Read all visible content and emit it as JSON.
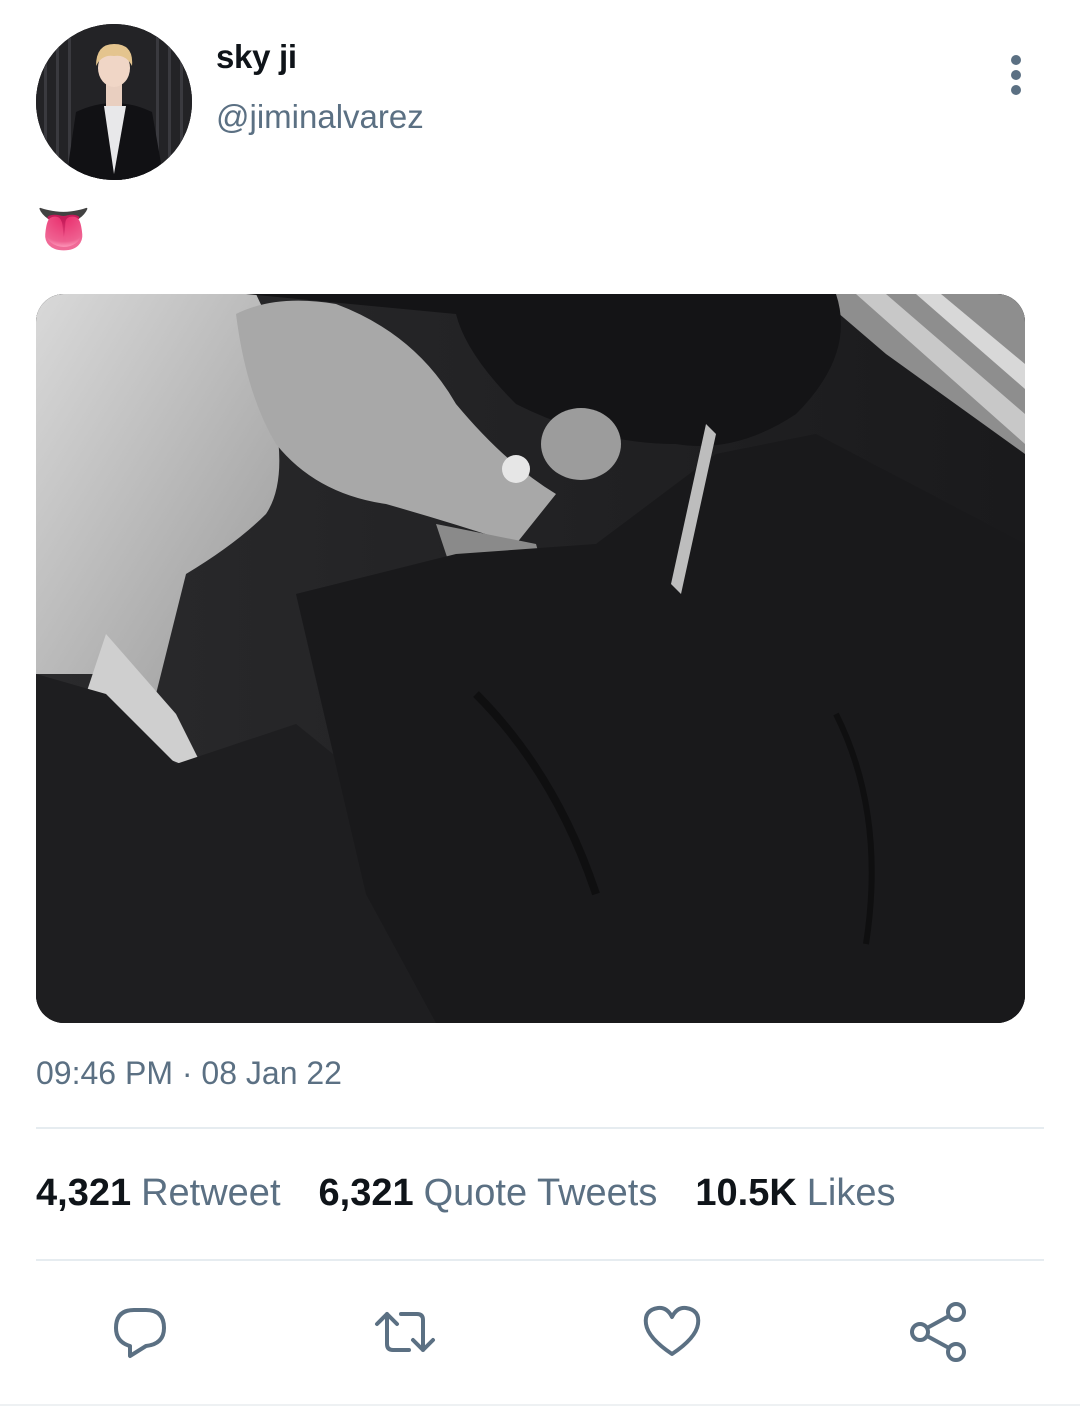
{
  "user": {
    "display_name": "sky ji",
    "handle": "@jiminalvarez",
    "avatar_icon": "profile-photo"
  },
  "tweet": {
    "text": "👅",
    "media_description_icon": "tweet-photo",
    "time": "09:46 PM",
    "separator": "·",
    "date": "08 Jan 22"
  },
  "stats": [
    {
      "count": "4,321",
      "label": "Retweet"
    },
    {
      "count": "6,321",
      "label": "Quote Tweets"
    },
    {
      "count": "10.5K",
      "label": "Likes"
    }
  ],
  "actions": {
    "reply_icon": "reply-icon",
    "retweet_icon": "retweet-icon",
    "like_icon": "heart-icon",
    "share_icon": "share-icon"
  },
  "colors": {
    "secondary_text": "#5b7083",
    "primary_text": "#0f1419",
    "divider": "#e6ecf0"
  }
}
